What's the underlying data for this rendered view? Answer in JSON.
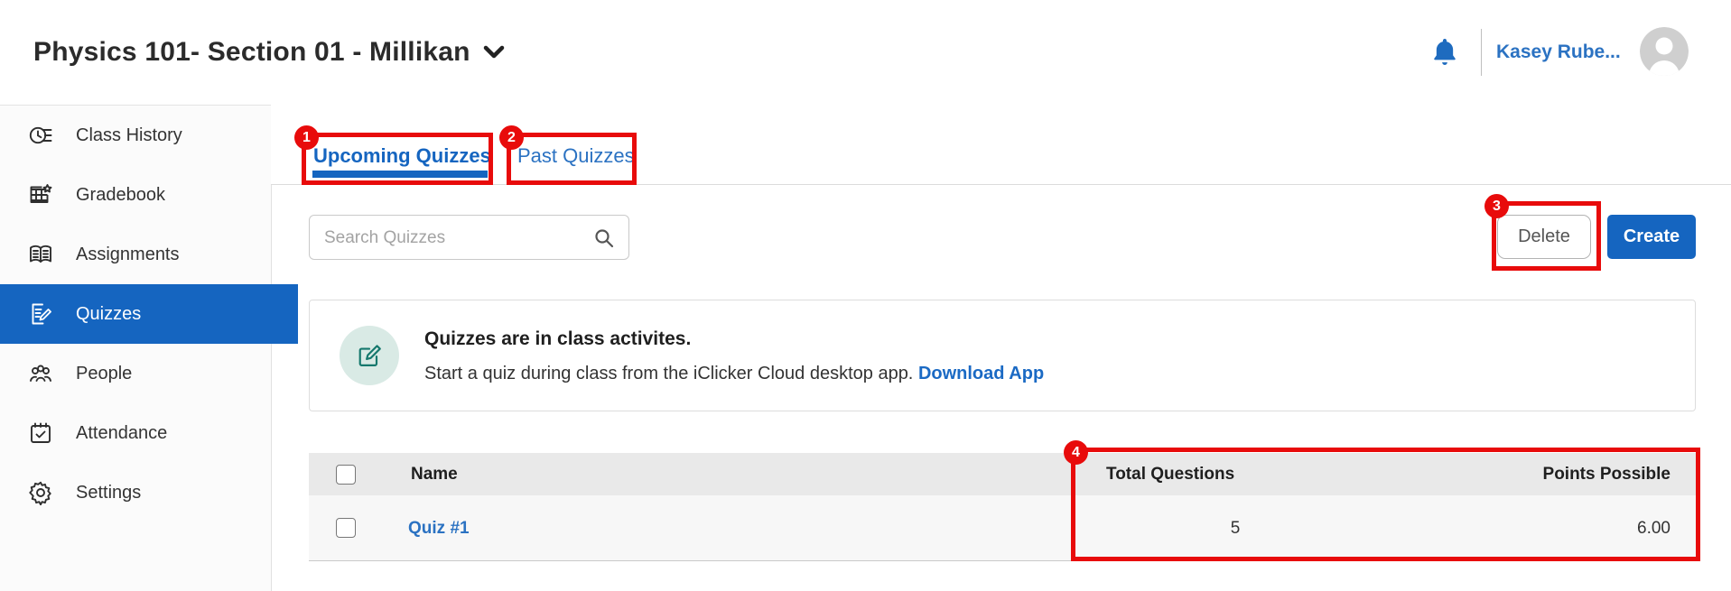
{
  "header": {
    "course_title": "Physics 101- Section 01 - Millikan",
    "user_name": "Kasey Rube..."
  },
  "sidebar": {
    "items": [
      {
        "label": "Class History",
        "icon": "clock-history-icon",
        "selected": false
      },
      {
        "label": "Gradebook",
        "icon": "gradebook-icon",
        "selected": false
      },
      {
        "label": "Assignments",
        "icon": "assignments-book-icon",
        "selected": false
      },
      {
        "label": "Quizzes",
        "icon": "quiz-pencil-icon",
        "selected": true
      },
      {
        "label": "People",
        "icon": "people-icon",
        "selected": false
      },
      {
        "label": "Attendance",
        "icon": "calendar-check-icon",
        "selected": false
      },
      {
        "label": "Settings",
        "icon": "gear-icon",
        "selected": false
      }
    ]
  },
  "tabs": [
    {
      "label": "Upcoming Quizzes",
      "active": true
    },
    {
      "label": "Past Quizzes",
      "active": false
    }
  ],
  "toolbar": {
    "search_placeholder": "Search Quizzes",
    "delete_label": "Delete",
    "create_label": "Create"
  },
  "info_card": {
    "title": "Quizzes are in class activites.",
    "body": "Start a quiz during class from the iClicker Cloud desktop app.",
    "link_label": "Download App"
  },
  "table": {
    "columns": [
      "Name",
      "Total Questions",
      "Points Possible"
    ],
    "rows": [
      {
        "name": "Quiz #1",
        "total_questions": "5",
        "points_possible": "6.00"
      }
    ]
  },
  "annotations": {
    "color": "#e80b0b",
    "badges": [
      "1",
      "2",
      "3",
      "4"
    ]
  },
  "colors": {
    "accent_blue": "#1565c0",
    "link_blue": "#2b72c2",
    "annotation_red": "#e80b0b",
    "card_icon_teal": "#15786d",
    "table_header_gray": "#e9e9e9"
  }
}
